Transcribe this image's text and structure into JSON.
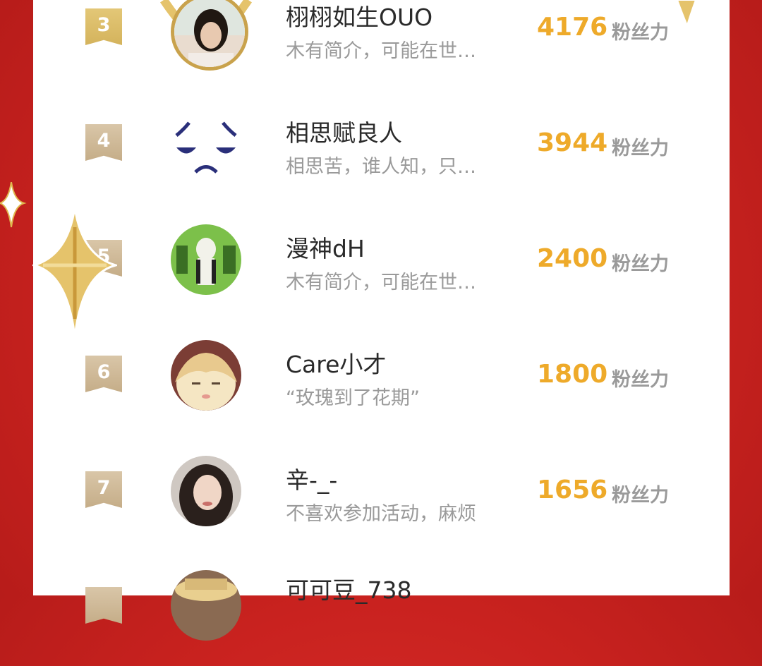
{
  "unit_label": "粉丝力",
  "rows": [
    {
      "rank": "3",
      "name": "栩栩如生OUO",
      "bio": "木有简介，可能在世…",
      "score": "4176"
    },
    {
      "rank": "4",
      "name": "相思赋良人",
      "bio": "相思苦，谁人知，只…",
      "score": "3944"
    },
    {
      "rank": "5",
      "name": "漫神dH",
      "bio": "木有简介，可能在世…",
      "score": "2400"
    },
    {
      "rank": "6",
      "name": "Care小才",
      "bio": "“玫瑰到了花期”",
      "score": "1800"
    },
    {
      "rank": "7",
      "name": "辛-_-",
      "bio": "不喜欢参加活动，麻烦",
      "score": "1656"
    },
    {
      "rank": "",
      "name": "可可豆_738",
      "bio": "",
      "score": ""
    }
  ],
  "colors": {
    "accent": "#eeaa2a",
    "background": "#c9221f",
    "rank_badge": "#c5ad88"
  }
}
